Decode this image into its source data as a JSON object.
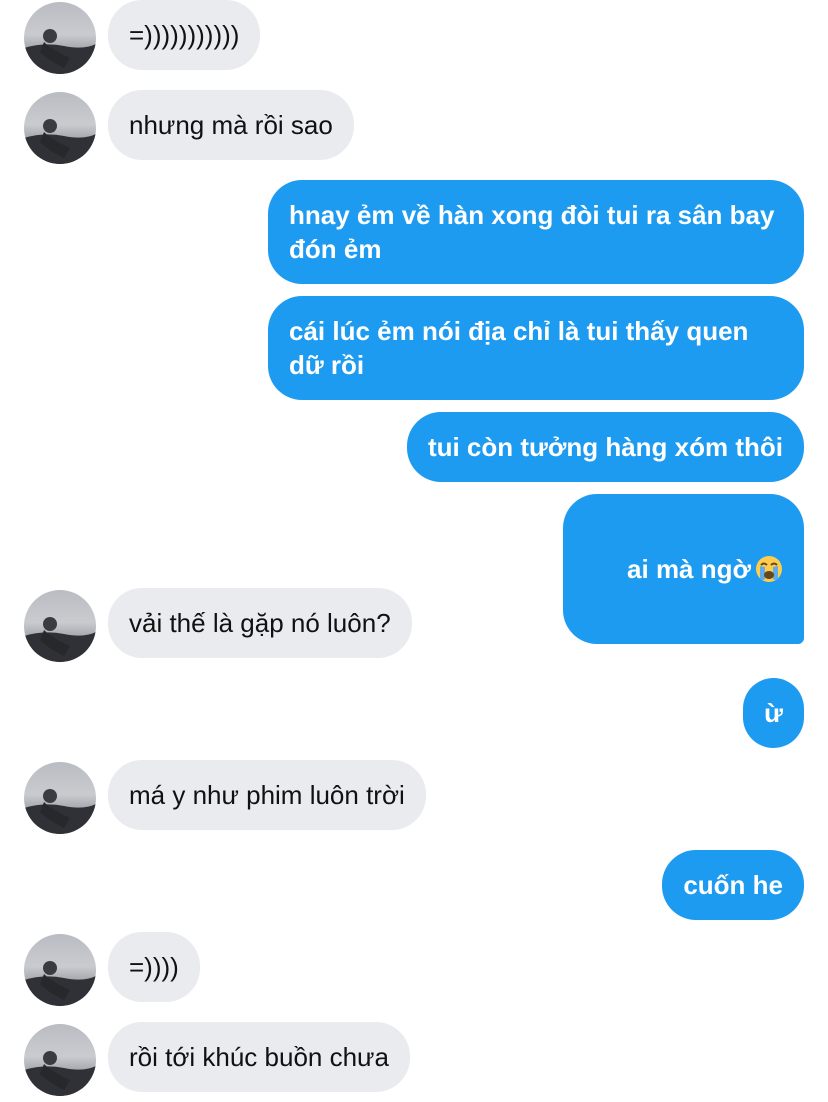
{
  "conversation": {
    "messages": [
      {
        "direction": "incoming",
        "text": "=)))))))))))"
      },
      {
        "direction": "incoming",
        "text": "nhưng mà rồi sao"
      },
      {
        "direction": "outgoing",
        "text": "hnay ẻm về hàn xong đòi tui ra sân bay đón ẻm"
      },
      {
        "direction": "outgoing",
        "text": "cái lúc ẻm nói địa chỉ là tui thấy quen dữ rồi"
      },
      {
        "direction": "outgoing",
        "text": "tui còn tưởng hàng xóm thôi"
      },
      {
        "direction": "outgoing",
        "text": "ai mà ngờ",
        "emoji": "loudly-crying-face-icon"
      },
      {
        "direction": "incoming",
        "text": "vải thế là gặp nó luôn?"
      },
      {
        "direction": "outgoing",
        "text": "ừ"
      },
      {
        "direction": "incoming",
        "text": "má y như phim luôn trời"
      },
      {
        "direction": "outgoing",
        "text": "cuốn he"
      },
      {
        "direction": "incoming",
        "text": "=))))"
      },
      {
        "direction": "incoming",
        "text": "rồi tới khúc buồn chưa"
      }
    ]
  },
  "colors": {
    "incoming_bubble": "#e9ebee",
    "outgoing_bubble": "#1d9bf0",
    "incoming_text": "#111111",
    "outgoing_text": "#ffffff"
  }
}
